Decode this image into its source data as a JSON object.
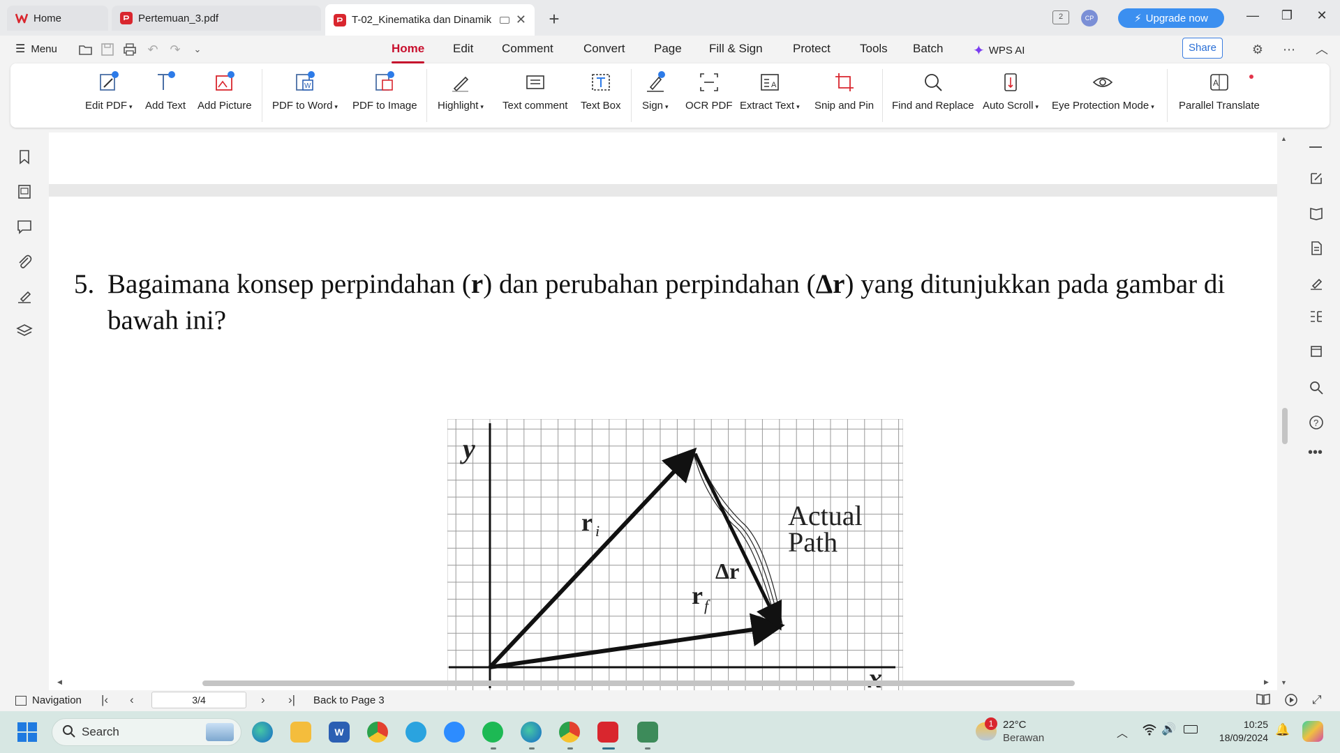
{
  "tabs": [
    {
      "label": "Home"
    },
    {
      "label": "Pertemuan_3.pdf"
    },
    {
      "label": "T-02_Kinematika dan Dinamik"
    }
  ],
  "titlebar": {
    "badge": "2",
    "avatar": "CP",
    "upgrade": "Upgrade now"
  },
  "menubar": {
    "menu": "Menu",
    "tabs": [
      "Home",
      "Edit",
      "Comment",
      "Convert",
      "Page",
      "Fill & Sign",
      "Protect",
      "Tools",
      "Batch",
      "WPS AI"
    ],
    "active_tab": "Home",
    "share": "Share"
  },
  "ribbon": {
    "items": [
      {
        "label": "Edit PDF",
        "icon": "edit-pdf-icon"
      },
      {
        "label": "Add Text",
        "icon": "add-text-icon"
      },
      {
        "label": "Add Picture",
        "icon": "add-picture-icon"
      },
      {
        "label": "PDF to Word",
        "icon": "pdf-to-word-icon"
      },
      {
        "label": "PDF to Image",
        "icon": "pdf-to-image-icon"
      },
      {
        "label": "Highlight",
        "icon": "highlight-icon"
      },
      {
        "label": "Text comment",
        "icon": "text-comment-icon"
      },
      {
        "label": "Text Box",
        "icon": "text-box-icon"
      },
      {
        "label": "Sign",
        "icon": "sign-icon"
      },
      {
        "label": "OCR PDF",
        "icon": "ocr-icon"
      },
      {
        "label": "Extract Text",
        "icon": "extract-text-icon"
      },
      {
        "label": "Snip and Pin",
        "icon": "snip-icon"
      },
      {
        "label": "Find and Replace",
        "icon": "search-icon"
      },
      {
        "label": "Auto Scroll",
        "icon": "auto-scroll-icon"
      },
      {
        "label": "Eye Protection Mode",
        "icon": "eye-icon"
      },
      {
        "label": "Parallel Translate",
        "icon": "translate-icon"
      }
    ]
  },
  "document": {
    "question_number": "5.",
    "question_part1": "Bagaimana konsep perpindahan (",
    "question_bold1": "r",
    "question_part2": ") dan perubahan perpindahan (",
    "question_bold2": "Δr",
    "question_part3": ") yang ditunjukkan pada gambar di bawah ini?",
    "figure": {
      "y_label": "y",
      "x_label": "x",
      "ri_label": "r",
      "ri_sub": "i",
      "rf_label": "r",
      "rf_sub": "f",
      "dr_label": "Δr",
      "path_label_1": "Actual",
      "path_label_2": "Path"
    }
  },
  "statusbar": {
    "navigation": "Navigation",
    "page": "3/4",
    "back": "Back to Page 3"
  },
  "taskbar": {
    "search": "Search",
    "weather_temp": "22°C",
    "weather_desc": "Berawan",
    "weather_badge": "1",
    "time": "10:25",
    "date": "18/09/2024"
  },
  "colors": {
    "accent": "#c8102e",
    "upgrade": "#3b8ff0",
    "taskbar": "#d7e7e3"
  }
}
